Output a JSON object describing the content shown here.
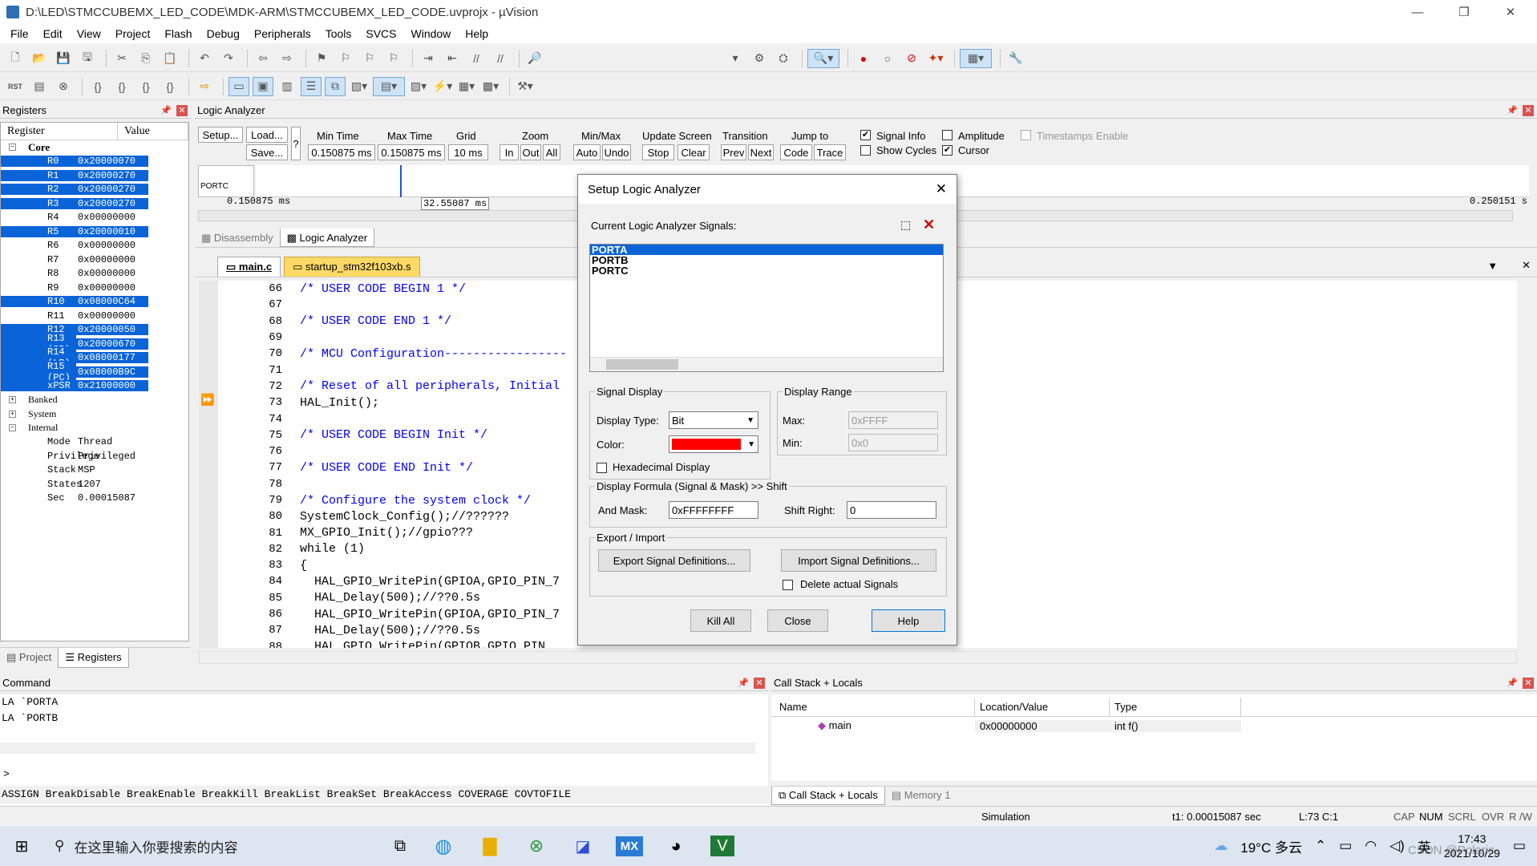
{
  "window": {
    "title": "D:\\LED\\STMCCUBEMX_LED_CODE\\MDK-ARM\\STMCCUBEMX_LED_CODE.uvprojx - µVision"
  },
  "menu": [
    "File",
    "Edit",
    "View",
    "Project",
    "Flash",
    "Debug",
    "Peripherals",
    "Tools",
    "SVCS",
    "Window",
    "Help"
  ],
  "registers": {
    "title": "Registers",
    "col_register": "Register",
    "col_value": "Value",
    "core_label": "Core",
    "rows": [
      {
        "name": "R0",
        "value": "0x20000070",
        "selected": true
      },
      {
        "name": "R1",
        "value": "0x20000270",
        "selected": true
      },
      {
        "name": "R2",
        "value": "0x20000270",
        "selected": true
      },
      {
        "name": "R3",
        "value": "0x20000270",
        "selected": true
      },
      {
        "name": "R4",
        "value": "0x00000000",
        "selected": false
      },
      {
        "name": "R5",
        "value": "0x20000010",
        "selected": true
      },
      {
        "name": "R6",
        "value": "0x00000000",
        "selected": false
      },
      {
        "name": "R7",
        "value": "0x00000000",
        "selected": false
      },
      {
        "name": "R8",
        "value": "0x00000000",
        "selected": false
      },
      {
        "name": "R9",
        "value": "0x00000000",
        "selected": false
      },
      {
        "name": "R10",
        "value": "0x08000C64",
        "selected": true
      },
      {
        "name": "R11",
        "value": "0x00000000",
        "selected": false
      },
      {
        "name": "R12",
        "value": "0x20000050",
        "selected": true
      },
      {
        "name": "R13 (SP)",
        "value": "0x20000670",
        "selected": true
      },
      {
        "name": "R14 (LR)",
        "value": "0x08000177",
        "selected": true
      },
      {
        "name": "R15 (PC)",
        "value": "0x08000B9C",
        "selected": true
      },
      {
        "name": "xPSR",
        "value": "0x21000000",
        "selected": true
      }
    ],
    "groups": [
      "Banked",
      "System",
      "Internal"
    ],
    "internal": [
      {
        "name": "Mode",
        "value": "Thread"
      },
      {
        "name": "Privilege",
        "value": "Privileged"
      },
      {
        "name": "Stack",
        "value": "MSP"
      },
      {
        "name": "States",
        "value": "1207"
      },
      {
        "name": "Sec",
        "value": "0.00015087"
      }
    ],
    "tabs": [
      "Project",
      "Registers"
    ]
  },
  "logic_analyzer": {
    "title": "Logic Analyzer",
    "setup_btn": "Setup...",
    "load_btn": "Load...",
    "save_btn": "Save...",
    "min_time_label": "Min Time",
    "min_time": "0.150875 ms",
    "max_time_label": "Max Time",
    "max_time": "0.150875 ms",
    "grid_label": "Grid",
    "grid": "10 ms",
    "zoom_label": "Zoom",
    "zoom_in": "In",
    "zoom_out": "Out",
    "zoom_all": "All",
    "minmax_label": "Min/Max",
    "auto": "Auto",
    "undo": "Undo",
    "update_label": "Update Screen",
    "stop": "Stop",
    "clear": "Clear",
    "transition_label": "Transition",
    "prev": "Prev",
    "next": "Next",
    "jump_label": "Jump to",
    "code": "Code",
    "trace": "Trace",
    "signal_info": "Signal Info",
    "show_cycles": "Show Cycles",
    "amplitude": "Amplitude",
    "cursor": "Cursor",
    "timestamps": "Timestamps Enable",
    "sig_row": "PORTC",
    "t_start": "0.150875 ms",
    "t_cursor": "32.55087 ms",
    "t_end": "0.250151 s",
    "tabs": [
      "Disassembly",
      "Logic Analyzer"
    ]
  },
  "editor": {
    "tabs": [
      "main.c",
      "startup_stm32f103xb.s"
    ],
    "lines": [
      {
        "n": "66",
        "t": "/* USER CODE BEGIN 1 */",
        "c": true
      },
      {
        "n": "67",
        "t": "",
        "c": false
      },
      {
        "n": "68",
        "t": "/* USER CODE END 1 */",
        "c": true
      },
      {
        "n": "69",
        "t": "",
        "c": false
      },
      {
        "n": "70",
        "t": "/* MCU Configuration-----------------",
        "c": true
      },
      {
        "n": "71",
        "t": "",
        "c": false
      },
      {
        "n": "72",
        "t": "/* Reset of all peripherals, Initial",
        "c": true
      },
      {
        "n": "73",
        "t": "HAL_Init();",
        "c": false
      },
      {
        "n": "74",
        "t": "",
        "c": false
      },
      {
        "n": "75",
        "t": "/* USER CODE BEGIN Init */",
        "c": true
      },
      {
        "n": "76",
        "t": "",
        "c": false
      },
      {
        "n": "77",
        "t": "/* USER CODE END Init */",
        "c": true
      },
      {
        "n": "78",
        "t": "",
        "c": false
      },
      {
        "n": "79",
        "t": "/* Configure the system clock */",
        "c": true
      },
      {
        "n": "80",
        "t": "SystemClock_Config();//??????",
        "c": false
      },
      {
        "n": "81",
        "t": "MX_GPIO_Init();//gpio???",
        "c": false
      },
      {
        "n": "82",
        "t": "while (1)",
        "c": false
      },
      {
        "n": "83",
        "t": "{",
        "c": false
      },
      {
        "n": "84",
        "t": "  HAL_GPIO_WritePin(GPIOA,GPIO_PIN_7",
        "c": false
      },
      {
        "n": "85",
        "t": "  HAL_Delay(500);//??0.5s",
        "c": false
      },
      {
        "n": "86",
        "t": "  HAL_GPIO_WritePin(GPIOA,GPIO_PIN_7",
        "c": false
      },
      {
        "n": "87",
        "t": "  HAL_Delay(500);//??0.5s",
        "c": false
      },
      {
        "n": "88",
        "t": "  HAL_GPIO_WritePin(GPIOB,GPIO_PIN_",
        "c": false
      }
    ]
  },
  "dialog": {
    "title": "Setup Logic Analyzer",
    "signals_label": "Current Logic Analyzer Signals:",
    "signals": [
      "PORTA",
      "PORTB",
      "PORTC"
    ],
    "signal_display": "Signal Display",
    "display_type_label": "Display Type:",
    "display_type": "Bit",
    "color_label": "Color:",
    "hex_display": "Hexadecimal Display",
    "display_range": "Display Range",
    "max_label": "Max:",
    "max": "0xFFFF",
    "min_label": "Min:",
    "min": "0x0",
    "formula_label": "Display Formula (Signal & Mask) >> Shift",
    "and_mask_label": "And Mask:",
    "and_mask": "0xFFFFFFFF",
    "shift_label": "Shift Right:",
    "shift": "0",
    "export_import": "Export / Import",
    "export_btn": "Export Signal Definitions...",
    "import_btn": "Import Signal Definitions...",
    "delete_actual": "Delete actual Signals",
    "kill_all": "Kill All",
    "close": "Close",
    "help": "Help",
    "signal_color": "#ff0000"
  },
  "command": {
    "title": "Command",
    "lines": [
      "LA `PORTA",
      "LA `PORTB"
    ],
    "prompt": ">",
    "hints": "ASSIGN BreakDisable BreakEnable BreakKill BreakList BreakSet BreakAccess COVERAGE COVTOFILE"
  },
  "callstack": {
    "title": "Call Stack + Locals",
    "cols": [
      "Name",
      "Location/Value",
      "Type"
    ],
    "row": {
      "name": "main",
      "value": "0x00000000",
      "type": "int f()"
    },
    "tabs": [
      "Call Stack + Locals",
      "Memory 1"
    ]
  },
  "status": {
    "mode": "Simulation",
    "t1": "t1: 0.00015087 sec",
    "pos": "L:73 C:1",
    "flags": [
      "CAP",
      "NUM",
      "SCRL",
      "OVR",
      "R /W"
    ]
  },
  "taskbar": {
    "search": "在这里输入你要搜索的内容",
    "weather": "19°C 多云",
    "ime": "英",
    "time": "17:43",
    "date": "2021/10/29",
    "watermark": "CSDN @Polaris·"
  }
}
